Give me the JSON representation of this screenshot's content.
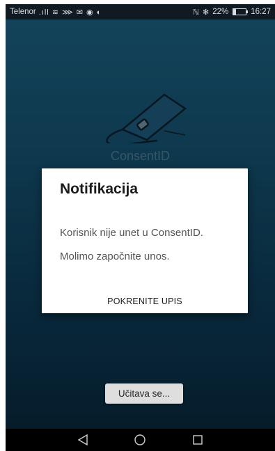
{
  "status_bar": {
    "carrier": "Telenor",
    "signal_icons": ".ıll ≋ ⋙ ✉ ◉ ◐",
    "nfc_bt_icons": "ℕ ✻",
    "battery_percent": "22%",
    "battery_level": 0.22,
    "time": "16:27"
  },
  "app": {
    "logo_text": "ConsentID"
  },
  "dialog": {
    "title": "Notifikacija",
    "message_line1": "Korisnik nije unet u ConsentID.",
    "message_line2": "Molimo započnite unos.",
    "action_label": "POKRENITE UPIS"
  },
  "loading": {
    "label": "Učitava se..."
  },
  "nav_bar": {
    "back_icon": "triangle-back-icon",
    "home_icon": "circle-home-icon",
    "recents_icon": "square-recents-icon"
  },
  "colors": {
    "background_top": "#1a5a78",
    "background_bottom": "#082639",
    "dialog_bg": "#ffffff"
  }
}
